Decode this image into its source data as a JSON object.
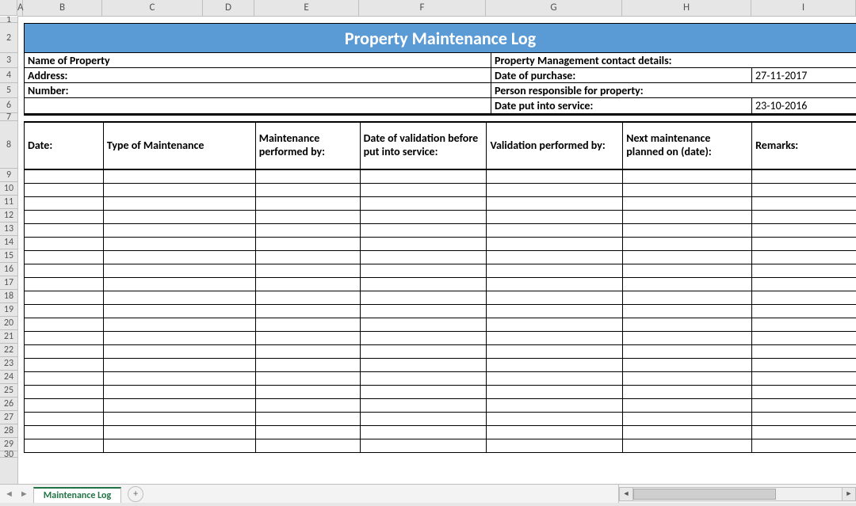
{
  "columns": [
    "A",
    "B",
    "C",
    "D",
    "E",
    "F",
    "G",
    "H",
    "I"
  ],
  "row_numbers": [
    1,
    2,
    3,
    4,
    5,
    6,
    7,
    8,
    9,
    10,
    11,
    12,
    13,
    14,
    15,
    16,
    17,
    18,
    19,
    20,
    21,
    22,
    23,
    24,
    25,
    26,
    27,
    28,
    29,
    30
  ],
  "title": "Property Maintenance Log",
  "info": {
    "name_of_property_label": "Name of Property",
    "address_label": "Address:",
    "number_label": "Number:",
    "mgmt_contact_label": "Property Management contact details:",
    "date_purchase_label": "Date of purchase:",
    "date_purchase_value": "27-11-2017",
    "person_resp_label": "Person responsible for property:",
    "date_service_label": "Date put into service:",
    "date_service_value": "23-10-2016"
  },
  "table_headers": {
    "date": "Date:",
    "type": "Type of Maintenance",
    "maint_by": "Maintenance performed by:",
    "validation_date": "Date of validation before put into service:",
    "validation_by": "Validation performed by:",
    "next_maint": "Next maintenance planned on (date):",
    "remarks": "Remarks:"
  },
  "data_row_count": 21,
  "sheet_tab": "Maintenance Log",
  "colors": {
    "banner": "#5b9bd5",
    "tab_active": "#217346"
  }
}
